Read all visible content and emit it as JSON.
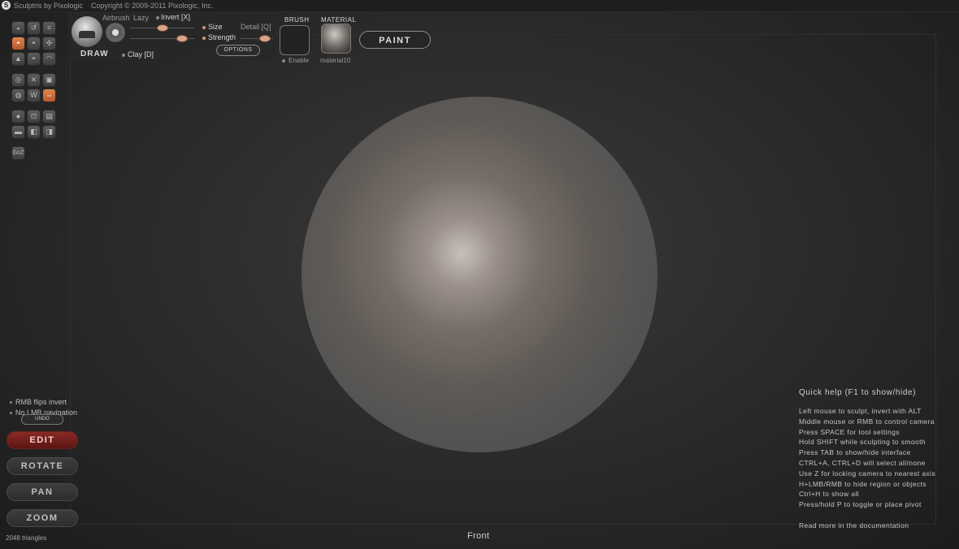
{
  "app": {
    "title": "Sculptris by Pixologic",
    "copyright": "Copyright © 2009-2011 Pixologic, Inc."
  },
  "brush": {
    "name": "DRAW",
    "airbrush_label": "Airbrush",
    "lazy_label": "Lazy",
    "invert_label": "Invert [X]",
    "clay_label": "Clay [D]",
    "size_label": "Size",
    "strength_label": "Strength",
    "detail_label": "Detail [Q]",
    "options_label": "OPTIONS"
  },
  "brush_slot": {
    "header": "BRUSH",
    "enable_label": "Enable"
  },
  "material": {
    "header": "MATERIAL",
    "name": "material10"
  },
  "paint_button": "PAINT",
  "left_options": [
    "RMB flips invert",
    "No LMB navigation"
  ],
  "undo_label": "UNDO",
  "modes": [
    {
      "label": "EDIT",
      "active": true
    },
    {
      "label": "ROTATE",
      "active": false
    },
    {
      "label": "PAN",
      "active": false
    },
    {
      "label": "ZOOM",
      "active": false
    }
  ],
  "status": {
    "triangles": "2048 triangles",
    "view": "Front"
  },
  "quick_help": {
    "title": "Quick help (F1 to show/hide)",
    "lines": [
      "Left mouse to sculpt, invert with ALT",
      "Middle mouse or RMB to control camera",
      "Press SPACE for tool settings",
      "Hold SHIFT while sculpting to smooth",
      "Press TAB to show/hide interface",
      "CTRL+A, CTRL+D will select all/none",
      "Use Z for locking camera to nearest axis",
      "H+LMB/RMB to hide region or objects",
      "Ctrl+H to show all",
      "Press/hold P to toggle or place pivot"
    ],
    "more": "Read more in the documentation"
  },
  "colors": {
    "accent": "#d9743f",
    "edit_active": "#7a2420",
    "knob": "#d9a58a"
  },
  "tool_icons": [
    "crease-icon",
    "rotate-icon",
    "crop-icon",
    "draw-icon",
    "inflate-icon",
    "pinch-icon",
    "grab-icon",
    "flatten-icon",
    "smooth-icon",
    "reduce-icon",
    "delete-icon",
    "subdivide-icon",
    "symmetry-icon",
    "wireframe-icon",
    "mirror-icon",
    "sphere-icon",
    "scale-icon",
    "gallery-icon",
    "hide-icon",
    "mask-icon",
    "mask-invert-icon",
    "go-z-icon"
  ]
}
